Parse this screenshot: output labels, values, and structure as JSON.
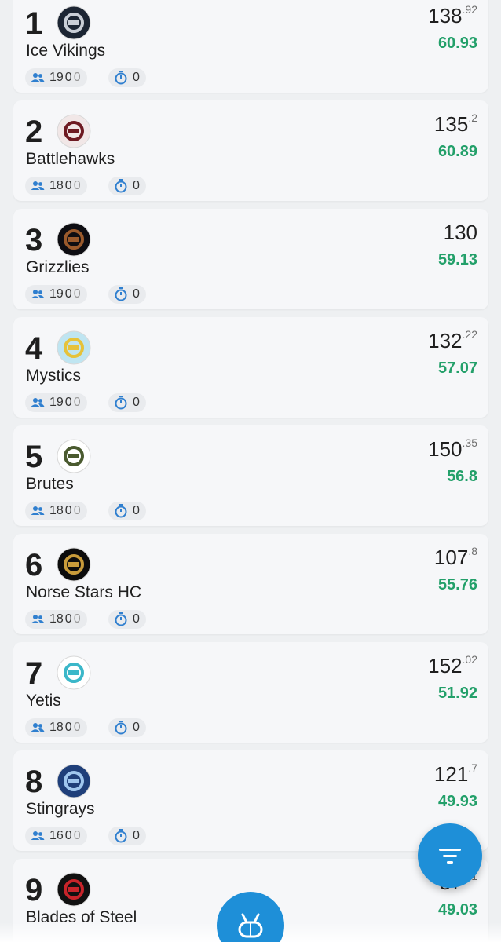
{
  "teams": [
    {
      "rank": "1",
      "name": "Ice Vikings",
      "players": "19",
      "zero_a": "0",
      "zero_b": "0",
      "timer": "0",
      "score_int": "138",
      "score_dec": ".92",
      "points": "60.93",
      "logo_color": "#1c2533",
      "logo_accent": "#c9ced6",
      "logo_icon": "viking-logo-icon"
    },
    {
      "rank": "2",
      "name": "Battlehawks",
      "players": "18",
      "zero_a": "0",
      "zero_b": "0",
      "timer": "0",
      "score_int": "135",
      "score_dec": ".2",
      "points": "60.89",
      "logo_color": "#f1e7e7",
      "logo_accent": "#6e1a22",
      "logo_icon": "hawk-logo-icon"
    },
    {
      "rank": "3",
      "name": "Grizzlies",
      "players": "19",
      "zero_a": "0",
      "zero_b": "0",
      "timer": "0",
      "score_int": "130",
      "score_dec": "",
      "points": "59.13",
      "logo_color": "#0d0d12",
      "logo_accent": "#9a5a2c",
      "logo_icon": "bear-logo-icon"
    },
    {
      "rank": "4",
      "name": "Mystics",
      "players": "19",
      "zero_a": "0",
      "zero_b": "0",
      "timer": "0",
      "score_int": "132",
      "score_dec": ".22",
      "points": "57.07",
      "logo_color": "#bfe5f1",
      "logo_accent": "#e6c23a",
      "logo_icon": "mystic-eye-logo-icon"
    },
    {
      "rank": "5",
      "name": "Brutes",
      "players": "18",
      "zero_a": "0",
      "zero_b": "0",
      "timer": "0",
      "score_int": "150",
      "score_dec": ".35",
      "points": "56.8",
      "logo_color": "#ffffff",
      "logo_accent": "#4a5a2f",
      "logo_icon": "brute-logo-icon"
    },
    {
      "rank": "6",
      "name": "Norse Stars HC",
      "players": "18",
      "zero_a": "0",
      "zero_b": "0",
      "timer": "0",
      "score_int": "107",
      "score_dec": ".8",
      "points": "55.76",
      "logo_color": "#0c0c0c",
      "logo_accent": "#c89b3a",
      "logo_icon": "norse-ship-logo-icon"
    },
    {
      "rank": "7",
      "name": "Yetis",
      "players": "18",
      "zero_a": "0",
      "zero_b": "0",
      "timer": "0",
      "score_int": "152",
      "score_dec": ".02",
      "points": "51.92",
      "logo_color": "#ffffff",
      "logo_accent": "#3bb7c9",
      "logo_icon": "yeti-logo-icon"
    },
    {
      "rank": "8",
      "name": "Stingrays",
      "players": "16",
      "zero_a": "0",
      "zero_b": "0",
      "timer": "0",
      "score_int": "121",
      "score_dec": ".7",
      "points": "49.93",
      "logo_color": "#1f3f7a",
      "logo_accent": "#9fc6ee",
      "logo_icon": "stingray-logo-icon"
    },
    {
      "rank": "9",
      "name": "Blades of Steel",
      "players": "",
      "zero_a": "",
      "zero_b": "",
      "timer": "",
      "score_int": "87",
      "score_dec": ".01",
      "points": "49.03",
      "logo_color": "#111111",
      "logo_accent": "#c8242a",
      "logo_icon": "blades-logo-icon"
    }
  ],
  "fab": {
    "icon": "filter-icon",
    "color": "#1e8fd8"
  },
  "nav": {
    "center_icon": "hockey-rink-icon"
  },
  "colors": {
    "points_green": "#23a06a",
    "badge_icon_blue": "#2f7fcf",
    "card_bg": "#f6f7f9"
  }
}
